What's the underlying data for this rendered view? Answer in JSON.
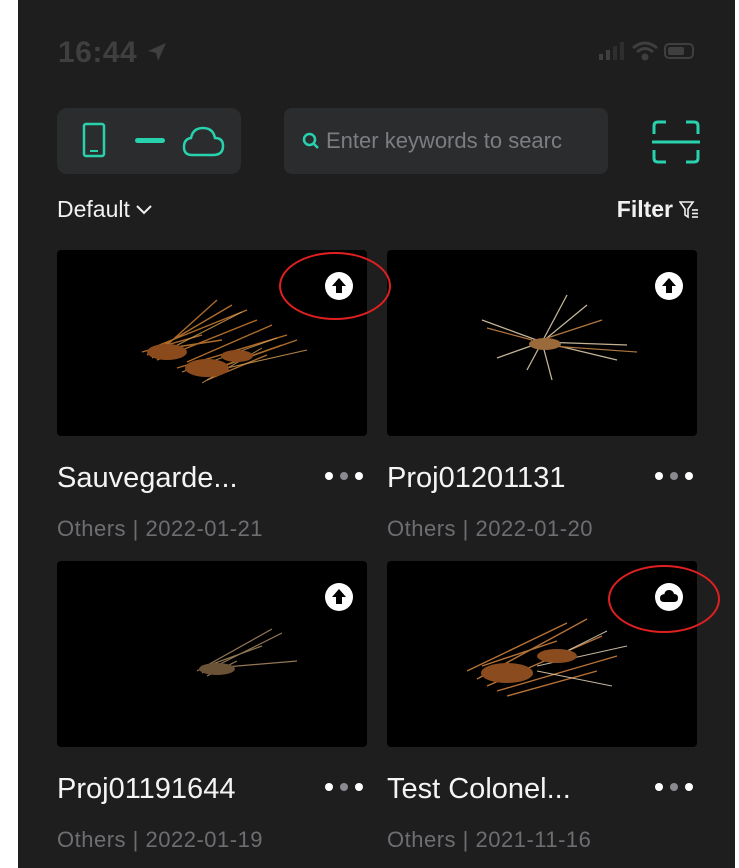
{
  "status": {
    "time": "16:44"
  },
  "toolbar": {
    "search_placeholder": "Enter keywords to searc"
  },
  "sort": {
    "label": "Default"
  },
  "filter": {
    "label": "Filter"
  },
  "projects": [
    {
      "title": "Sauvegarde...",
      "category": "Others",
      "separator": "|",
      "date": "2022-01-21",
      "status_icon": "upload-icon"
    },
    {
      "title": "Proj01201131",
      "category": "Others",
      "separator": "|",
      "date": "2022-01-20",
      "status_icon": "upload-icon"
    },
    {
      "title": "Proj01191644",
      "category": "Others",
      "separator": "|",
      "date": "2022-01-19",
      "status_icon": "upload-icon"
    },
    {
      "title": "Test Colonel...",
      "category": "Others",
      "separator": "|",
      "date": "2021-11-16",
      "status_icon": "cloud-icon"
    }
  ],
  "colors": {
    "accent": "#27d2ad",
    "background": "#1e1e1f",
    "card": "#000000",
    "annotation": "#e02020"
  }
}
